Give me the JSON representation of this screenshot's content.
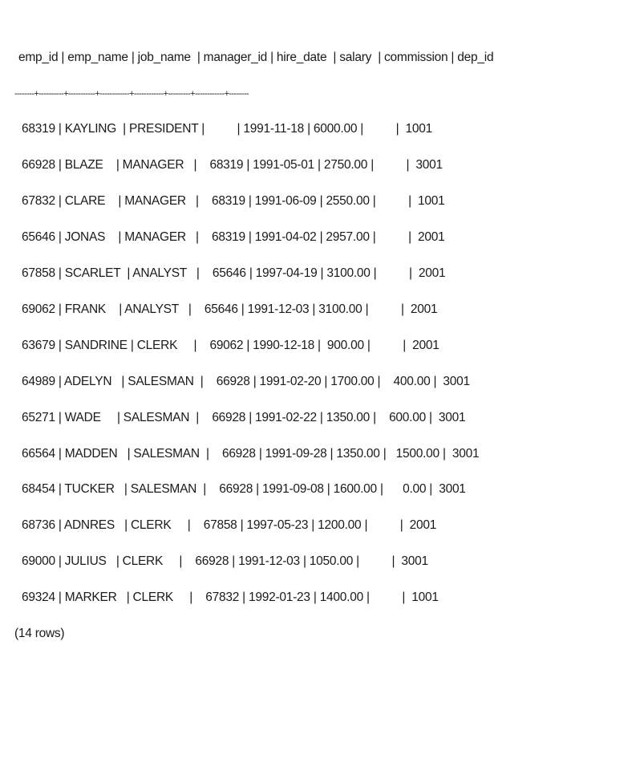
{
  "result": {
    "columns": [
      "emp_id",
      "emp_name",
      "job_name",
      "manager_id",
      "hire_date",
      "salary",
      "commission",
      "dep_id"
    ],
    "header_line": "emp_id | emp_name | job_name  | manager_id | hire_date  | salary  | commission | dep_id",
    "separator_line": "--------+----------+-----------+------------+------------+---------+------------+--------",
    "rows": [
      {
        "emp_id": "68319",
        "emp_name": "KAYLING",
        "job_name": "PRESIDENT",
        "manager_id": "",
        "hire_date": "1991-11-18",
        "salary": "6000.00",
        "commission": "",
        "dep_id": "1001",
        "line": "68319 | KAYLING  | PRESIDENT |          | 1991-11-18 | 6000.00 |          |  1001"
      },
      {
        "emp_id": "66928",
        "emp_name": "BLAZE",
        "job_name": "MANAGER",
        "manager_id": "68319",
        "hire_date": "1991-05-01",
        "salary": "2750.00",
        "commission": "",
        "dep_id": "3001",
        "line": "66928 | BLAZE    | MANAGER   |    68319 | 1991-05-01 | 2750.00 |          |  3001"
      },
      {
        "emp_id": "67832",
        "emp_name": "CLARE",
        "job_name": "MANAGER",
        "manager_id": "68319",
        "hire_date": "1991-06-09",
        "salary": "2550.00",
        "commission": "",
        "dep_id": "1001",
        "line": "67832 | CLARE    | MANAGER   |    68319 | 1991-06-09 | 2550.00 |          |  1001"
      },
      {
        "emp_id": "65646",
        "emp_name": "JONAS",
        "job_name": "MANAGER",
        "manager_id": "68319",
        "hire_date": "1991-04-02",
        "salary": "2957.00",
        "commission": "",
        "dep_id": "2001",
        "line": "65646 | JONAS    | MANAGER   |    68319 | 1991-04-02 | 2957.00 |          |  2001"
      },
      {
        "emp_id": "67858",
        "emp_name": "SCARLET",
        "job_name": "ANALYST",
        "manager_id": "65646",
        "hire_date": "1997-04-19",
        "salary": "3100.00",
        "commission": "",
        "dep_id": "2001",
        "line": "67858 | SCARLET  | ANALYST   |    65646 | 1997-04-19 | 3100.00 |          |  2001"
      },
      {
        "emp_id": "69062",
        "emp_name": "FRANK",
        "job_name": "ANALYST",
        "manager_id": "65646",
        "hire_date": "1991-12-03",
        "salary": "3100.00",
        "commission": "",
        "dep_id": "2001",
        "line": "69062 | FRANK    | ANALYST   |    65646 | 1991-12-03 | 3100.00 |          |  2001"
      },
      {
        "emp_id": "63679",
        "emp_name": "SANDRINE",
        "job_name": "CLERK",
        "manager_id": "69062",
        "hire_date": "1990-12-18",
        "salary": "900.00",
        "commission": "",
        "dep_id": "2001",
        "line": "63679 | SANDRINE | CLERK     |    69062 | 1990-12-18 |  900.00 |          |  2001"
      },
      {
        "emp_id": "64989",
        "emp_name": "ADELYN",
        "job_name": "SALESMAN",
        "manager_id": "66928",
        "hire_date": "1991-02-20",
        "salary": "1700.00",
        "commission": "400.00",
        "dep_id": "3001",
        "line": "64989 | ADELYN   | SALESMAN  |    66928 | 1991-02-20 | 1700.00 |    400.00 |  3001"
      },
      {
        "emp_id": "65271",
        "emp_name": "WADE",
        "job_name": "SALESMAN",
        "manager_id": "66928",
        "hire_date": "1991-02-22",
        "salary": "1350.00",
        "commission": "600.00",
        "dep_id": "3001",
        "line": "65271 | WADE     | SALESMAN  |    66928 | 1991-02-22 | 1350.00 |    600.00 |  3001"
      },
      {
        "emp_id": "66564",
        "emp_name": "MADDEN",
        "job_name": "SALESMAN",
        "manager_id": "66928",
        "hire_date": "1991-09-28",
        "salary": "1350.00",
        "commission": "1500.00",
        "dep_id": "3001",
        "line": "66564 | MADDEN   | SALESMAN  |    66928 | 1991-09-28 | 1350.00 |   1500.00 |  3001"
      },
      {
        "emp_id": "68454",
        "emp_name": "TUCKER",
        "job_name": "SALESMAN",
        "manager_id": "66928",
        "hire_date": "1991-09-08",
        "salary": "1600.00",
        "commission": "0.00",
        "dep_id": "3001",
        "line": "68454 | TUCKER   | SALESMAN  |    66928 | 1991-09-08 | 1600.00 |      0.00 |  3001"
      },
      {
        "emp_id": "68736",
        "emp_name": "ADNRES",
        "job_name": "CLERK",
        "manager_id": "67858",
        "hire_date": "1997-05-23",
        "salary": "1200.00",
        "commission": "",
        "dep_id": "2001",
        "line": "68736 | ADNRES   | CLERK     |    67858 | 1997-05-23 | 1200.00 |          |  2001"
      },
      {
        "emp_id": "69000",
        "emp_name": "JULIUS",
        "job_name": "CLERK",
        "manager_id": "66928",
        "hire_date": "1991-12-03",
        "salary": "1050.00",
        "commission": "",
        "dep_id": "3001",
        "line": "69000 | JULIUS   | CLERK     |    66928 | 1991-12-03 | 1050.00 |          |  3001"
      },
      {
        "emp_id": "69324",
        "emp_name": "MARKER",
        "job_name": "CLERK",
        "manager_id": "67832",
        "hire_date": "1992-01-23",
        "salary": "1400.00",
        "commission": "",
        "dep_id": "1001",
        "line": "69324 | MARKER   | CLERK     |    67832 | 1992-01-23 | 1400.00 |          |  1001"
      }
    ],
    "row_count_label": "(14 rows)"
  }
}
